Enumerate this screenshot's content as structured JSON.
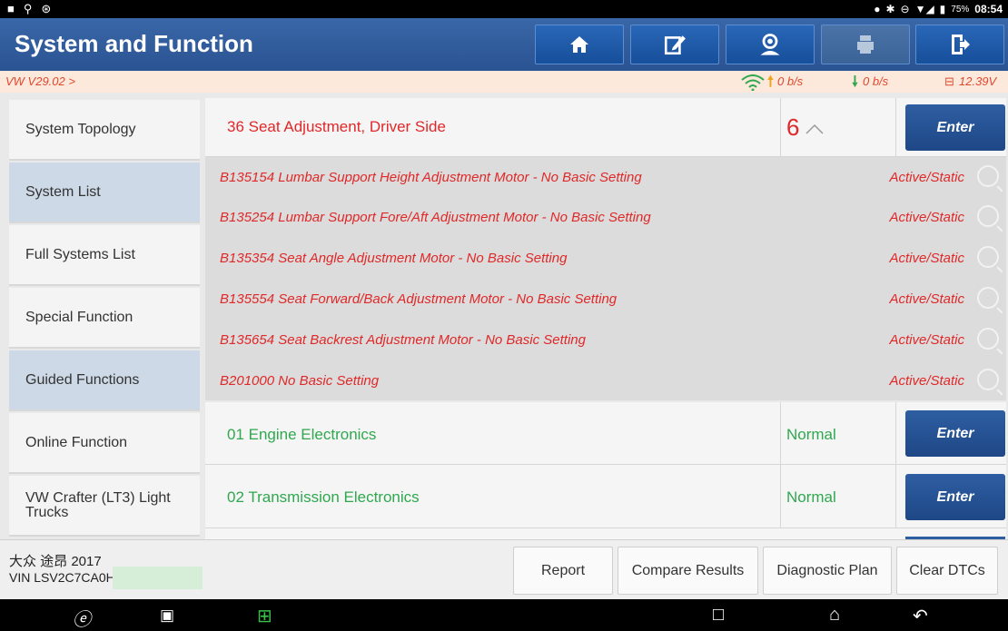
{
  "status_bar": {
    "battery": "75%",
    "time": "08:54"
  },
  "header": {
    "title": "System and Function",
    "buttons": [
      {
        "name": "home-icon"
      },
      {
        "name": "edit-icon"
      },
      {
        "name": "support-icon"
      },
      {
        "name": "print-icon"
      },
      {
        "name": "exit-icon"
      }
    ]
  },
  "info_bar": {
    "version": "VW V29.02 >",
    "upload": "0 b/s",
    "download": "0 b/s",
    "voltage": "12.39V"
  },
  "sidebar": {
    "items": [
      {
        "label": "System Topology",
        "active": false
      },
      {
        "label": "System List",
        "active": true
      },
      {
        "label": "Full Systems List",
        "active": false
      },
      {
        "label": "Special Function",
        "active": false
      },
      {
        "label": "Guided Functions",
        "active": true
      },
      {
        "label": "Online Function",
        "active": false
      },
      {
        "label": "VW Crafter (LT3) Light Trucks",
        "active": false
      }
    ],
    "collapse_glyph": "K"
  },
  "systems": [
    {
      "name": "36 Seat Adjustment, Driver Side",
      "status": "6",
      "enter": "Enter",
      "color": "#e0282a"
    },
    {
      "name": "01 Engine Electronics",
      "status": "Normal",
      "enter": "Enter",
      "color": "#2fa84f"
    },
    {
      "name": "02 Transmission Electronics",
      "status": "Normal",
      "enter": "Enter",
      "color": "#2fa84f"
    }
  ],
  "dtcs": [
    {
      "code": "B135154 Lumbar Support Height Adjustment Motor - No Basic Setting",
      "state": "Active/Static"
    },
    {
      "code": "B135254 Lumbar Support Fore/Aft Adjustment Motor - No Basic Setting",
      "state": "Active/Static"
    },
    {
      "code": "B135354 Seat Angle Adjustment Motor - No Basic Setting",
      "state": "Active/Static"
    },
    {
      "code": "B135554 Seat Forward/Back Adjustment Motor - No Basic Setting",
      "state": "Active/Static"
    },
    {
      "code": "B135654 Seat Backrest Adjustment Motor - No Basic Setting",
      "state": "Active/Static"
    },
    {
      "code": "B201000 No Basic Setting",
      "state": "Active/Static"
    }
  ],
  "footer": {
    "vehicle": "大众 途昂 2017",
    "vin": "VIN LSV2C7CA0H",
    "buttons": [
      "Report",
      "Compare Results",
      "Diagnostic Plan",
      "Clear DTCs"
    ]
  },
  "colors": {
    "accent": "#2a5392",
    "dtc_red": "#e0282a",
    "normal_green": "#2fa84f"
  }
}
